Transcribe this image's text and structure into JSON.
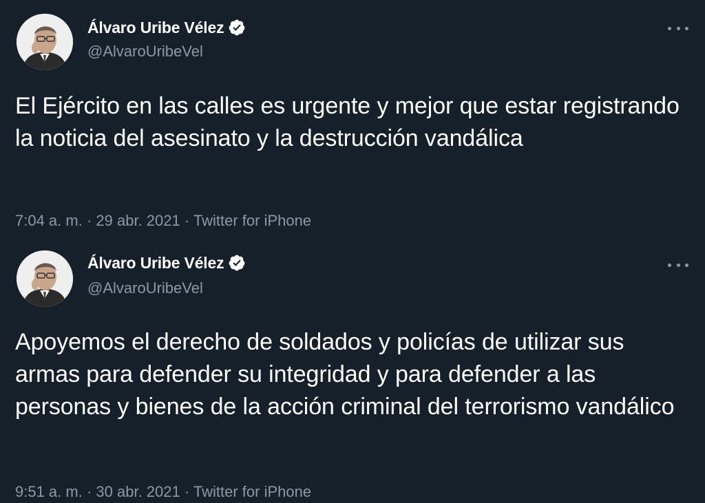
{
  "tweets": [
    {
      "display_name": "Álvaro Uribe Vélez",
      "handle": "@AlvaroUribeVel",
      "text": "El Ejército en las calles es urgente y mejor que estar registrando la noticia del asesinato y la destrucción vandálica",
      "time": "7:04 a. m.",
      "separator": " · ",
      "date": "29 abr. 2021",
      "source": "Twitter for iPhone",
      "verified_icon": "verified-badge-icon",
      "more_icon": "more-options-icon"
    },
    {
      "display_name": "Álvaro Uribe Vélez",
      "handle": "@AlvaroUribeVel",
      "text": "Apoyemos el derecho de soldados y policías de utilizar sus armas para defender su integridad y para defender a las personas y bienes de la acción criminal del terrorismo vandálico",
      "time": "9:51 a. m.",
      "separator": " · ",
      "date": "30 abr. 2021",
      "source": "Twitter for iPhone",
      "verified_icon": "verified-badge-icon",
      "more_icon": "more-options-icon"
    }
  ],
  "colors": {
    "background": "#15202b",
    "primary_text": "#ffffff",
    "secondary_text": "#8b98a5"
  }
}
